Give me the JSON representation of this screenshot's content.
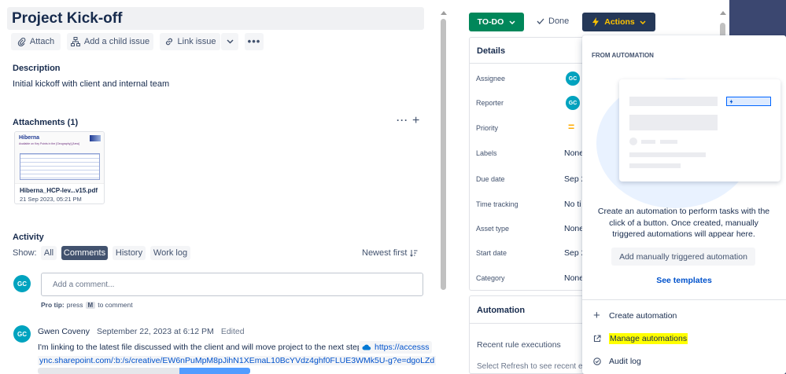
{
  "issue": {
    "title": "Project Kick-off",
    "toolbar": {
      "attach": "Attach",
      "add_child": "Add a child issue",
      "link_issue": "Link issue"
    },
    "description_heading": "Description",
    "description_text": "Initial kickoff with client and internal team",
    "attachments_heading": "Attachments (1)",
    "attachment": {
      "filename": "Hiberna_HCP-lev...v15.pdf",
      "date": "21 Sep 2023, 05:21 PM",
      "thumb_brand": "Hiberna",
      "thumb_caption": "Available on Key Points in the [Geography] [Area]"
    }
  },
  "activity": {
    "heading": "Activity",
    "show_label": "Show:",
    "filters": [
      "All",
      "Comments",
      "History",
      "Work log"
    ],
    "active_filter": "Comments",
    "sort": "Newest first",
    "comment_placeholder": "Add a comment...",
    "pro_tip_prefix": "Pro tip:",
    "pro_tip_press": "press",
    "pro_tip_key": "M",
    "pro_tip_suffix": "to comment",
    "avatar_initials": "GC",
    "comment": {
      "author": "Gwen Coveny",
      "date": "September 22, 2023 at 6:12 PM",
      "edited": "Edited",
      "text": "I'm linking to the latest file discussed with the client and will move project to the next step.",
      "link_text": "https://accesss",
      "link_line2": "ync.sharepoint.com/:b:/s/creative/EW6nPuMpM8pJihN1XEmaL10BcYVdz4ghf0FLUE3WMk5U-g?e=dgoLZd"
    }
  },
  "status": {
    "todo_label": "TO-DO",
    "done_label": "Done",
    "actions_label": "Actions"
  },
  "details": {
    "heading": "Details",
    "fields": [
      {
        "label": "Assignee",
        "value": "GC"
      },
      {
        "label": "Reporter",
        "value": "GC"
      },
      {
        "label": "Priority",
        "value": "="
      },
      {
        "label": "Labels",
        "value": "None"
      },
      {
        "label": "Due date",
        "value": "Sep 2"
      },
      {
        "label": "Time tracking",
        "value": "No ti"
      },
      {
        "label": "Asset type",
        "value": "None"
      },
      {
        "label": "Start date",
        "value": "Sep 2"
      },
      {
        "label": "Category",
        "value": "None"
      }
    ],
    "automation_heading": "Automation",
    "recent_rule": "Recent rule executions",
    "refresh_text": "Select Refresh to see recent ex"
  },
  "actions_menu": {
    "section_title": "FROM AUTOMATION",
    "empty_text": "Create an automation to perform tasks with the click of a button. Once created, manually triggered automations will appear here.",
    "add_button": "Add manually triggered automation",
    "see_templates": "See templates",
    "items": [
      {
        "label": "Create automation",
        "icon": "plus-icon"
      },
      {
        "label": "Manage automations",
        "icon": "external-link-icon"
      },
      {
        "label": "Audit log",
        "icon": "check-circle-icon"
      }
    ]
  },
  "colors": {
    "todo_green": "#00875a",
    "actions_bg": "#253858",
    "actions_text": "#ffc400",
    "highlight_yellow": "#ffff00",
    "link_blue": "#0052cc",
    "avatar_teal": "#00a3bf",
    "comments_filter_bg": "#42526e"
  }
}
